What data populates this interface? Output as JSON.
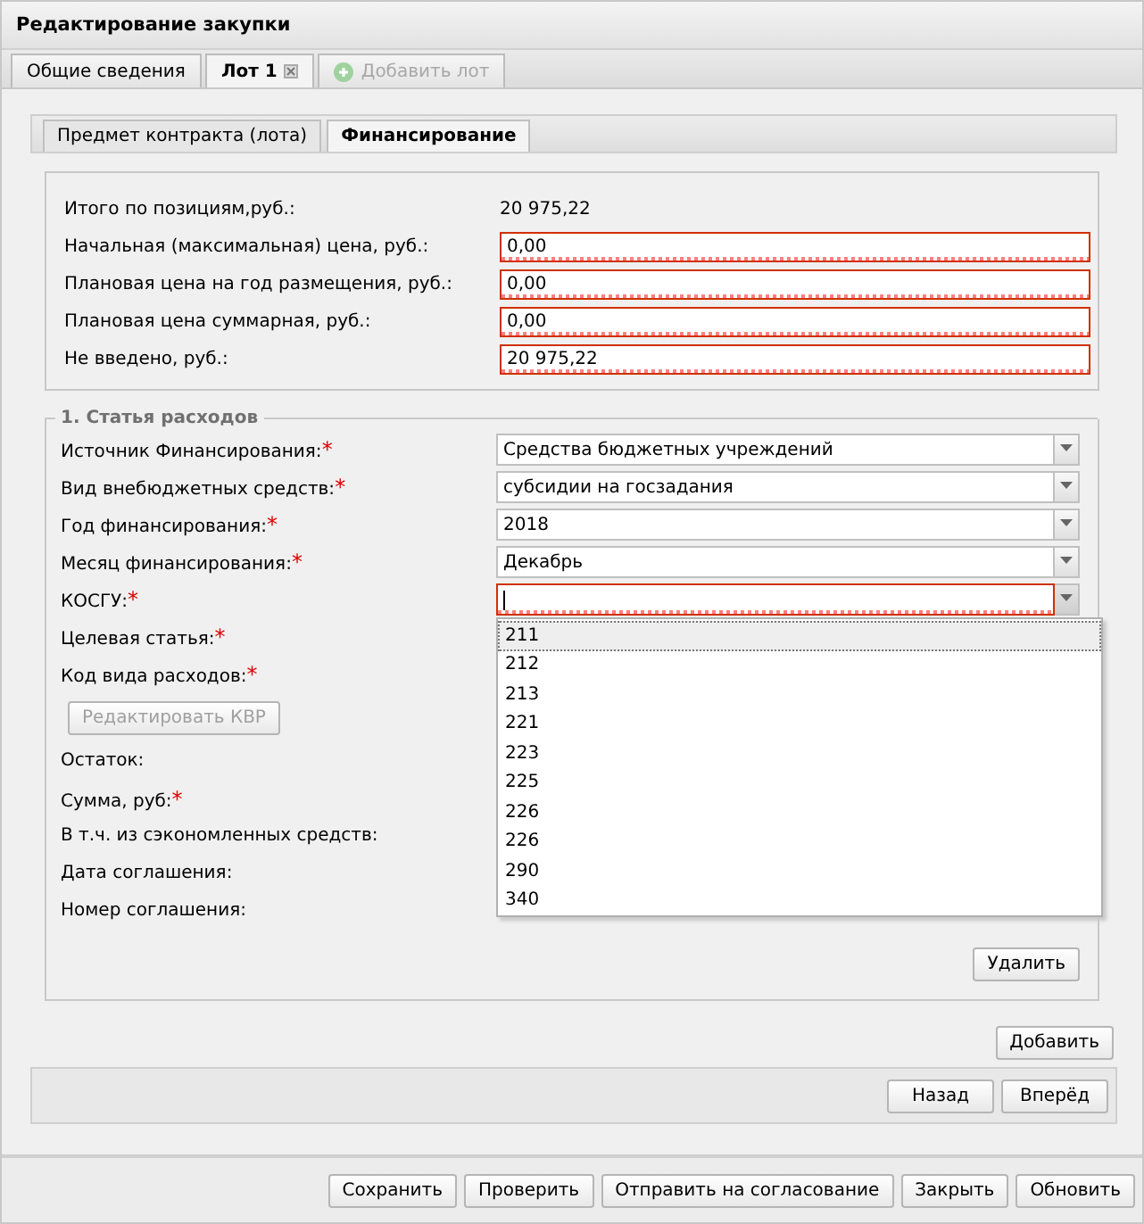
{
  "window": {
    "title": "Редактирование закупки"
  },
  "tabs": [
    {
      "label": "Общие сведения",
      "selected": false,
      "kind": "plain",
      "disabled": false
    },
    {
      "label": "Лот 1",
      "selected": true,
      "kind": "closable",
      "disabled": false
    },
    {
      "label": "Добавить лот",
      "selected": false,
      "kind": "add",
      "disabled": true
    }
  ],
  "subtabs": [
    {
      "label": "Предмет контракта (лота)",
      "selected": false
    },
    {
      "label": "Финансирование",
      "selected": true
    }
  ],
  "summary": [
    {
      "label": "Итого по позициям,руб.:",
      "value": "20 975,22",
      "kind": "text"
    },
    {
      "label": "Начальная (максимальная) цена, руб.:",
      "value": "0,00",
      "kind": "input",
      "invalid": true
    },
    {
      "label": "Плановая цена на год размещения, руб.:",
      "value": "0,00",
      "kind": "input",
      "invalid": true
    },
    {
      "label": "Плановая цена суммарная, руб.:",
      "value": "0,00",
      "kind": "input",
      "invalid": true
    },
    {
      "label": "Не введено, руб.:",
      "value": "20 975,22",
      "kind": "input",
      "invalid": true
    }
  ],
  "expense": {
    "legend": "1. Статья расходов",
    "rows": [
      {
        "kind": "select",
        "label": "Источник Финансирования:",
        "required_mark": "*",
        "value": "Средства бюджетных учреждений",
        "invalid": false
      },
      {
        "kind": "select",
        "label": "Вид внебюджетных средств:",
        "required_mark": "*",
        "value": "субсидии на госзадания",
        "invalid": false
      },
      {
        "kind": "select",
        "label": "Год финансирования:",
        "required_mark": "*",
        "value": "2018",
        "invalid": false
      },
      {
        "kind": "select",
        "label": "Месяц финансирования:",
        "required_mark": "*",
        "value": "Декабрь",
        "invalid": false
      },
      {
        "kind": "combo",
        "label": "КОСГУ:",
        "required_mark": "*",
        "invalid": true,
        "expanded": true
      },
      {
        "kind": "label",
        "label": "Целевая статья:",
        "required_mark": "*"
      },
      {
        "kind": "label",
        "label": "Код вида расходов:",
        "required_mark": "*"
      },
      {
        "kind": "button",
        "label": "Редактировать КВР",
        "disabled": true
      },
      {
        "kind": "label",
        "label": "Остаток:"
      },
      {
        "kind": "label",
        "label": "Сумма, руб:",
        "required_mark": "*"
      },
      {
        "kind": "label",
        "label": "В т.ч. из сэкономленных средств:"
      },
      {
        "kind": "label",
        "label": "Дата соглашения:"
      },
      {
        "kind": "label",
        "label": "Номер соглашения:"
      }
    ],
    "options": [
      {
        "label": "211",
        "selected": true
      },
      {
        "label": "212",
        "selected": false
      },
      {
        "label": "213",
        "selected": false
      },
      {
        "label": "221",
        "selected": false
      },
      {
        "label": "223",
        "selected": false
      },
      {
        "label": "225",
        "selected": false
      },
      {
        "label": "226",
        "selected": false
      },
      {
        "label": "226",
        "selected": false
      },
      {
        "label": "290",
        "selected": false
      },
      {
        "label": "340",
        "selected": false
      }
    ],
    "delete_button": "Удалить"
  },
  "add_button": "Добавить",
  "nav_buttons": [
    "Назад",
    "Вперёд"
  ],
  "footer_buttons": [
    "Сохранить",
    "Проверить",
    "Отправить на согласование",
    "Закрыть",
    "Обновить"
  ]
}
